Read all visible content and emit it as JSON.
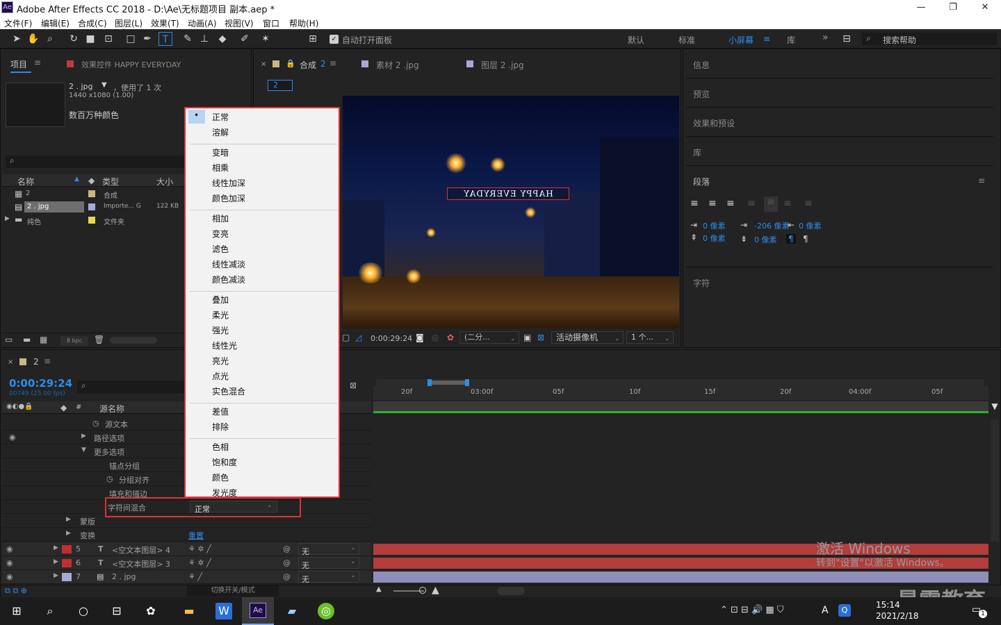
{
  "window": {
    "title": "Adobe After Effects CC 2018 - D:\\Ae\\无标题项目 副本.aep *",
    "logo": "Ae",
    "minimize": "—",
    "maximize": "❐",
    "close": "✕"
  },
  "menu": [
    "文件(F)",
    "编辑(E)",
    "合成(C)",
    "图层(L)",
    "效果(T)",
    "动画(A)",
    "视图(V)",
    "窗口",
    "帮助(H)"
  ],
  "toolbar": {
    "auto_open": "自动打开面板",
    "workspaces": [
      "默认",
      "标准",
      "小屏幕",
      "库"
    ],
    "active_workspace": "小屏幕",
    "search_placeholder": "搜索帮助",
    "menu_icon": "≡",
    "overflow": "»"
  },
  "project": {
    "tab": "项目",
    "effects_tab": "效果控件 HAPPY EVERYDAY",
    "file_name": "2 . jpg",
    "used": "，使用了 1 次",
    "dims": "1440 x1080 (1.00)",
    "colors": "数百万种颜色",
    "col_name": "名称",
    "col_type": "类型",
    "col_size": "大小",
    "items": [
      {
        "name": "2",
        "type": "合成",
        "size": ""
      },
      {
        "name": "2 . jpg",
        "type": "Importe... G",
        "size": "122 KB"
      },
      {
        "name": "纯色",
        "type": "文件夹",
        "size": ""
      }
    ],
    "bpc": "8 bpc"
  },
  "viewer": {
    "tabs": [
      "合成",
      "素材 2 .jpg",
      "图层 2 .jpg"
    ],
    "comp_num": "2",
    "comp_button": "2",
    "sign_text": "HAPPY EVERYDAY",
    "timecode": "0:00:29:24",
    "resolution": "(二分...",
    "camera": "活动摄像机",
    "views": "1 个..."
  },
  "dropdown": {
    "groups": [
      [
        "正常",
        "溶解"
      ],
      [
        "变暗",
        "相乘",
        "线性加深",
        "颜色加深"
      ],
      [
        "相加",
        "变亮",
        "滤色",
        "线性减淡",
        "颜色减淡"
      ],
      [
        "叠加",
        "柔光",
        "强光",
        "线性光",
        "亮光",
        "点光",
        "实色混合"
      ],
      [
        "差值",
        "排除"
      ],
      [
        "色相",
        "饱和度",
        "颜色",
        "发光度"
      ]
    ],
    "selected": "正常"
  },
  "right_panels": {
    "items": [
      "信息",
      "预览",
      "效果和预设",
      "库"
    ],
    "paragraph": "段落",
    "character": "字符",
    "indent_left": "0 像素",
    "indent_first": "-206 像素",
    "indent_right": "0 像素",
    "space_before": "0 像素",
    "space_after": "0 像素"
  },
  "timeline": {
    "tab": "2",
    "timecode": "0:00:29:24",
    "fps": "00749 (25.00 fps)",
    "col_source": "源名称",
    "col_hash": "#",
    "ruler": [
      "20f",
      "03:00f",
      "05f",
      "10f",
      "15f",
      "20f",
      "04:00f",
      "05f"
    ],
    "props": [
      "源文本",
      "路径选项",
      "更多选项",
      "锚点分组",
      "分组对齐",
      "填充和描边",
      "字符间混合",
      "蒙版",
      "变换"
    ],
    "blend_value": "正常",
    "reset": "重置",
    "layers": [
      {
        "num": "5",
        "type": "T",
        "name": "<空文本图层> 4",
        "mode": "无"
      },
      {
        "num": "6",
        "type": "T",
        "name": "<空文本图层> 3",
        "mode": "无"
      },
      {
        "num": "7",
        "type": "",
        "name": "2 . jpg",
        "mode": "无"
      }
    ],
    "toggle": "切换开关/模式"
  },
  "watermark": {
    "line1": "激活 Windows",
    "line2": "转到\"设置\"以激活 Windows。",
    "brand": "最需教育"
  },
  "taskbar": {
    "time": "15:14",
    "date": "2021/2/18",
    "ime": "A",
    "badge": "1"
  },
  "colors": {
    "accent": "#2d8ceb",
    "highlight": "#e0303a",
    "layer_red": "#b33c3c",
    "layer_lav": "#8e8eb8"
  }
}
